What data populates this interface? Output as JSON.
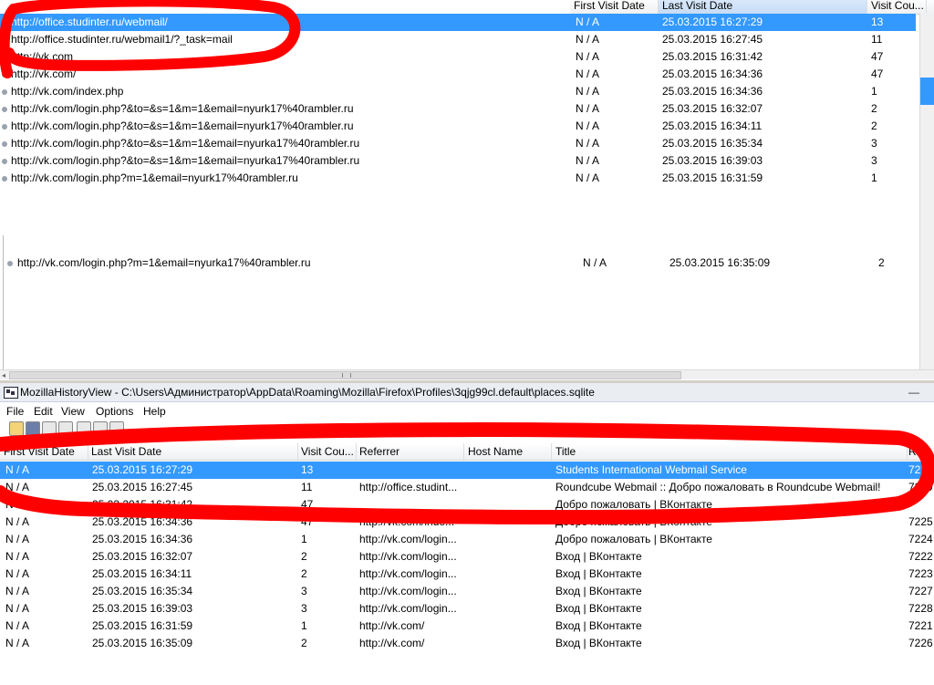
{
  "top_table": {
    "columns": [
      "First Visit Date",
      "Last Visit Date",
      "Visit Cou..."
    ],
    "rows": [
      {
        "url": "http://office.studinter.ru/webmail/",
        "first": "N / A",
        "last": "25.03.2015 16:27:29",
        "count": "13"
      },
      {
        "url": "http://office.studinter.ru/webmail1/?_task=mail",
        "first": "N / A",
        "last": "25.03.2015 16:27:45",
        "count": "11"
      },
      {
        "url": "http://vk.com",
        "first": "N / A",
        "last": "25.03.2015 16:31:42",
        "count": "47"
      },
      {
        "url": "http://vk.com/",
        "first": "N / A",
        "last": "25.03.2015 16:34:36",
        "count": "47"
      },
      {
        "url": "http://vk.com/index.php",
        "first": "N / A",
        "last": "25.03.2015 16:34:36",
        "count": "1"
      },
      {
        "url": "http://vk.com/login.php?&to=&s=1&m=1&email=nyurk17%40rambler.ru",
        "first": "N / A",
        "last": "25.03.2015 16:32:07",
        "count": "2"
      },
      {
        "url": "http://vk.com/login.php?&to=&s=1&m=1&email=nyurk17%40rambler.ru",
        "first": "N / A",
        "last": "25.03.2015 16:34:11",
        "count": "2"
      },
      {
        "url": "http://vk.com/login.php?&to=&s=1&m=1&email=nyurka17%40rambler.ru",
        "first": "N / A",
        "last": "25.03.2015 16:35:34",
        "count": "3"
      },
      {
        "url": "http://vk.com/login.php?&to=&s=1&m=1&email=nyurka17%40rambler.ru",
        "first": "N / A",
        "last": "25.03.2015 16:39:03",
        "count": "3"
      },
      {
        "url": "http://vk.com/login.php?m=1&email=nyurk17%40rambler.ru",
        "first": "N / A",
        "last": "25.03.2015 16:31:59",
        "count": "1"
      }
    ],
    "extra_row": {
      "url": "http://vk.com/login.php?m=1&email=nyurka17%40rambler.ru",
      "first": "N / A",
      "last": "25.03.2015 16:35:09",
      "count": "2"
    }
  },
  "window": {
    "title": "MozillaHistoryView  -  C:\\Users\\Администратор\\AppData\\Roaming\\Mozilla\\Firefox\\Profiles\\3qjg99cl.default\\places.sqlite",
    "menu": [
      "File",
      "Edit",
      "View",
      "Options",
      "Help"
    ],
    "minimize_glyph": "—"
  },
  "bottom_table": {
    "columns": [
      "First Visit Date",
      "Last Visit Date",
      "Visit Cou...",
      "Referrer",
      "Host Name",
      "Title",
      "Rec"
    ],
    "rows": [
      {
        "first": "N / A",
        "last": "25.03.2015 16:27:29",
        "count": "13",
        "ref": "",
        "host": "",
        "title": "Students International Webmail Service",
        "rec": "7218"
      },
      {
        "first": "N / A",
        "last": "25.03.2015 16:27:45",
        "count": "11",
        "ref": "http://office.studint...",
        "host": "",
        "title": "Roundcube Webmail :: Добро пожаловать в Roundcube Webmail!",
        "rec": "7219"
      },
      {
        "first": "N / A",
        "last": "25.03.2015 16:31:42",
        "count": "47",
        "ref": "",
        "host": "",
        "title": "Добро пожаловать | ВКонтакте",
        "rec": ""
      },
      {
        "first": "N / A",
        "last": "25.03.2015 16:34:36",
        "count": "47",
        "ref": "http://vk.com/inde...",
        "host": "",
        "title": "Добро пожаловать | ВКонтакте",
        "rec": "7225"
      },
      {
        "first": "N / A",
        "last": "25.03.2015 16:34:36",
        "count": "1",
        "ref": "http://vk.com/login...",
        "host": "",
        "title": "Добро пожаловать | ВКонтакте",
        "rec": "7224"
      },
      {
        "first": "N / A",
        "last": "25.03.2015 16:32:07",
        "count": "2",
        "ref": "http://vk.com/login...",
        "host": "",
        "title": "Вход | ВКонтакте",
        "rec": "7222"
      },
      {
        "first": "N / A",
        "last": "25.03.2015 16:34:11",
        "count": "2",
        "ref": "http://vk.com/login...",
        "host": "",
        "title": "Вход | ВКонтакте",
        "rec": "7223"
      },
      {
        "first": "N / A",
        "last": "25.03.2015 16:35:34",
        "count": "3",
        "ref": "http://vk.com/login...",
        "host": "",
        "title": "Вход | ВКонтакте",
        "rec": "7227"
      },
      {
        "first": "N / A",
        "last": "25.03.2015 16:39:03",
        "count": "3",
        "ref": "http://vk.com/login...",
        "host": "",
        "title": "Вход | ВКонтакте",
        "rec": "7228"
      },
      {
        "first": "N / A",
        "last": "25.03.2015 16:31:59",
        "count": "1",
        "ref": "http://vk.com/",
        "host": "",
        "title": "Вход | ВКонтакте",
        "rec": "7221"
      },
      {
        "first": "N / A",
        "last": "25.03.2015 16:35:09",
        "count": "2",
        "ref": "http://vk.com/",
        "host": "",
        "title": "Вход | ВКонтакте",
        "rec": "7226"
      }
    ]
  },
  "colors": {
    "selection": "#3399ff",
    "annotation": "#ff0000"
  },
  "icons": [
    "bullet-icon",
    "app-icon",
    "open-icon",
    "save-icon",
    "copy-icon",
    "properties-icon",
    "find-icon",
    "refresh-icon",
    "exit-icon"
  ]
}
